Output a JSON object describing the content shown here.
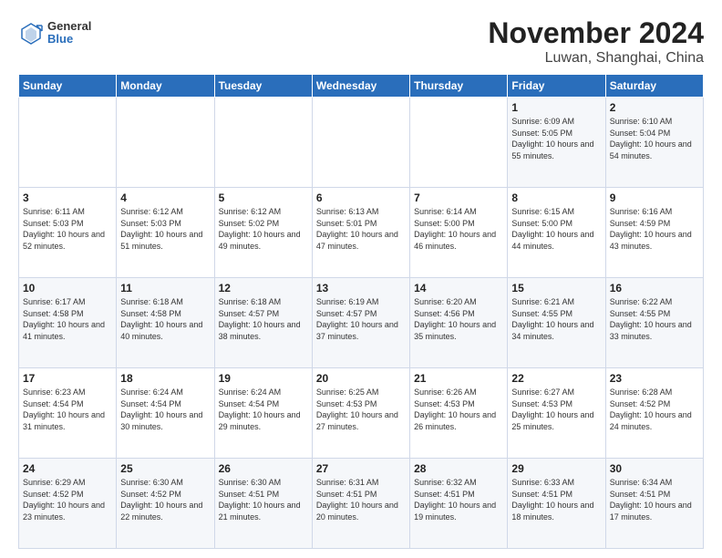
{
  "logo": {
    "general": "General",
    "blue": "Blue"
  },
  "title": "November 2024",
  "subtitle": "Luwan, Shanghai, China",
  "headers": [
    "Sunday",
    "Monday",
    "Tuesday",
    "Wednesday",
    "Thursday",
    "Friday",
    "Saturday"
  ],
  "weeks": [
    [
      {
        "day": "",
        "sunrise": "",
        "sunset": "",
        "daylight": ""
      },
      {
        "day": "",
        "sunrise": "",
        "sunset": "",
        "daylight": ""
      },
      {
        "day": "",
        "sunrise": "",
        "sunset": "",
        "daylight": ""
      },
      {
        "day": "",
        "sunrise": "",
        "sunset": "",
        "daylight": ""
      },
      {
        "day": "",
        "sunrise": "",
        "sunset": "",
        "daylight": ""
      },
      {
        "day": "1",
        "sunrise": "Sunrise: 6:09 AM",
        "sunset": "Sunset: 5:05 PM",
        "daylight": "Daylight: 10 hours and 55 minutes."
      },
      {
        "day": "2",
        "sunrise": "Sunrise: 6:10 AM",
        "sunset": "Sunset: 5:04 PM",
        "daylight": "Daylight: 10 hours and 54 minutes."
      }
    ],
    [
      {
        "day": "3",
        "sunrise": "Sunrise: 6:11 AM",
        "sunset": "Sunset: 5:03 PM",
        "daylight": "Daylight: 10 hours and 52 minutes."
      },
      {
        "day": "4",
        "sunrise": "Sunrise: 6:12 AM",
        "sunset": "Sunset: 5:03 PM",
        "daylight": "Daylight: 10 hours and 51 minutes."
      },
      {
        "day": "5",
        "sunrise": "Sunrise: 6:12 AM",
        "sunset": "Sunset: 5:02 PM",
        "daylight": "Daylight: 10 hours and 49 minutes."
      },
      {
        "day": "6",
        "sunrise": "Sunrise: 6:13 AM",
        "sunset": "Sunset: 5:01 PM",
        "daylight": "Daylight: 10 hours and 47 minutes."
      },
      {
        "day": "7",
        "sunrise": "Sunrise: 6:14 AM",
        "sunset": "Sunset: 5:00 PM",
        "daylight": "Daylight: 10 hours and 46 minutes."
      },
      {
        "day": "8",
        "sunrise": "Sunrise: 6:15 AM",
        "sunset": "Sunset: 5:00 PM",
        "daylight": "Daylight: 10 hours and 44 minutes."
      },
      {
        "day": "9",
        "sunrise": "Sunrise: 6:16 AM",
        "sunset": "Sunset: 4:59 PM",
        "daylight": "Daylight: 10 hours and 43 minutes."
      }
    ],
    [
      {
        "day": "10",
        "sunrise": "Sunrise: 6:17 AM",
        "sunset": "Sunset: 4:58 PM",
        "daylight": "Daylight: 10 hours and 41 minutes."
      },
      {
        "day": "11",
        "sunrise": "Sunrise: 6:18 AM",
        "sunset": "Sunset: 4:58 PM",
        "daylight": "Daylight: 10 hours and 40 minutes."
      },
      {
        "day": "12",
        "sunrise": "Sunrise: 6:18 AM",
        "sunset": "Sunset: 4:57 PM",
        "daylight": "Daylight: 10 hours and 38 minutes."
      },
      {
        "day": "13",
        "sunrise": "Sunrise: 6:19 AM",
        "sunset": "Sunset: 4:57 PM",
        "daylight": "Daylight: 10 hours and 37 minutes."
      },
      {
        "day": "14",
        "sunrise": "Sunrise: 6:20 AM",
        "sunset": "Sunset: 4:56 PM",
        "daylight": "Daylight: 10 hours and 35 minutes."
      },
      {
        "day": "15",
        "sunrise": "Sunrise: 6:21 AM",
        "sunset": "Sunset: 4:55 PM",
        "daylight": "Daylight: 10 hours and 34 minutes."
      },
      {
        "day": "16",
        "sunrise": "Sunrise: 6:22 AM",
        "sunset": "Sunset: 4:55 PM",
        "daylight": "Daylight: 10 hours and 33 minutes."
      }
    ],
    [
      {
        "day": "17",
        "sunrise": "Sunrise: 6:23 AM",
        "sunset": "Sunset: 4:54 PM",
        "daylight": "Daylight: 10 hours and 31 minutes."
      },
      {
        "day": "18",
        "sunrise": "Sunrise: 6:24 AM",
        "sunset": "Sunset: 4:54 PM",
        "daylight": "Daylight: 10 hours and 30 minutes."
      },
      {
        "day": "19",
        "sunrise": "Sunrise: 6:24 AM",
        "sunset": "Sunset: 4:54 PM",
        "daylight": "Daylight: 10 hours and 29 minutes."
      },
      {
        "day": "20",
        "sunrise": "Sunrise: 6:25 AM",
        "sunset": "Sunset: 4:53 PM",
        "daylight": "Daylight: 10 hours and 27 minutes."
      },
      {
        "day": "21",
        "sunrise": "Sunrise: 6:26 AM",
        "sunset": "Sunset: 4:53 PM",
        "daylight": "Daylight: 10 hours and 26 minutes."
      },
      {
        "day": "22",
        "sunrise": "Sunrise: 6:27 AM",
        "sunset": "Sunset: 4:53 PM",
        "daylight": "Daylight: 10 hours and 25 minutes."
      },
      {
        "day": "23",
        "sunrise": "Sunrise: 6:28 AM",
        "sunset": "Sunset: 4:52 PM",
        "daylight": "Daylight: 10 hours and 24 minutes."
      }
    ],
    [
      {
        "day": "24",
        "sunrise": "Sunrise: 6:29 AM",
        "sunset": "Sunset: 4:52 PM",
        "daylight": "Daylight: 10 hours and 23 minutes."
      },
      {
        "day": "25",
        "sunrise": "Sunrise: 6:30 AM",
        "sunset": "Sunset: 4:52 PM",
        "daylight": "Daylight: 10 hours and 22 minutes."
      },
      {
        "day": "26",
        "sunrise": "Sunrise: 6:30 AM",
        "sunset": "Sunset: 4:51 PM",
        "daylight": "Daylight: 10 hours and 21 minutes."
      },
      {
        "day": "27",
        "sunrise": "Sunrise: 6:31 AM",
        "sunset": "Sunset: 4:51 PM",
        "daylight": "Daylight: 10 hours and 20 minutes."
      },
      {
        "day": "28",
        "sunrise": "Sunrise: 6:32 AM",
        "sunset": "Sunset: 4:51 PM",
        "daylight": "Daylight: 10 hours and 19 minutes."
      },
      {
        "day": "29",
        "sunrise": "Sunrise: 6:33 AM",
        "sunset": "Sunset: 4:51 PM",
        "daylight": "Daylight: 10 hours and 18 minutes."
      },
      {
        "day": "30",
        "sunrise": "Sunrise: 6:34 AM",
        "sunset": "Sunset: 4:51 PM",
        "daylight": "Daylight: 10 hours and 17 minutes."
      }
    ]
  ]
}
